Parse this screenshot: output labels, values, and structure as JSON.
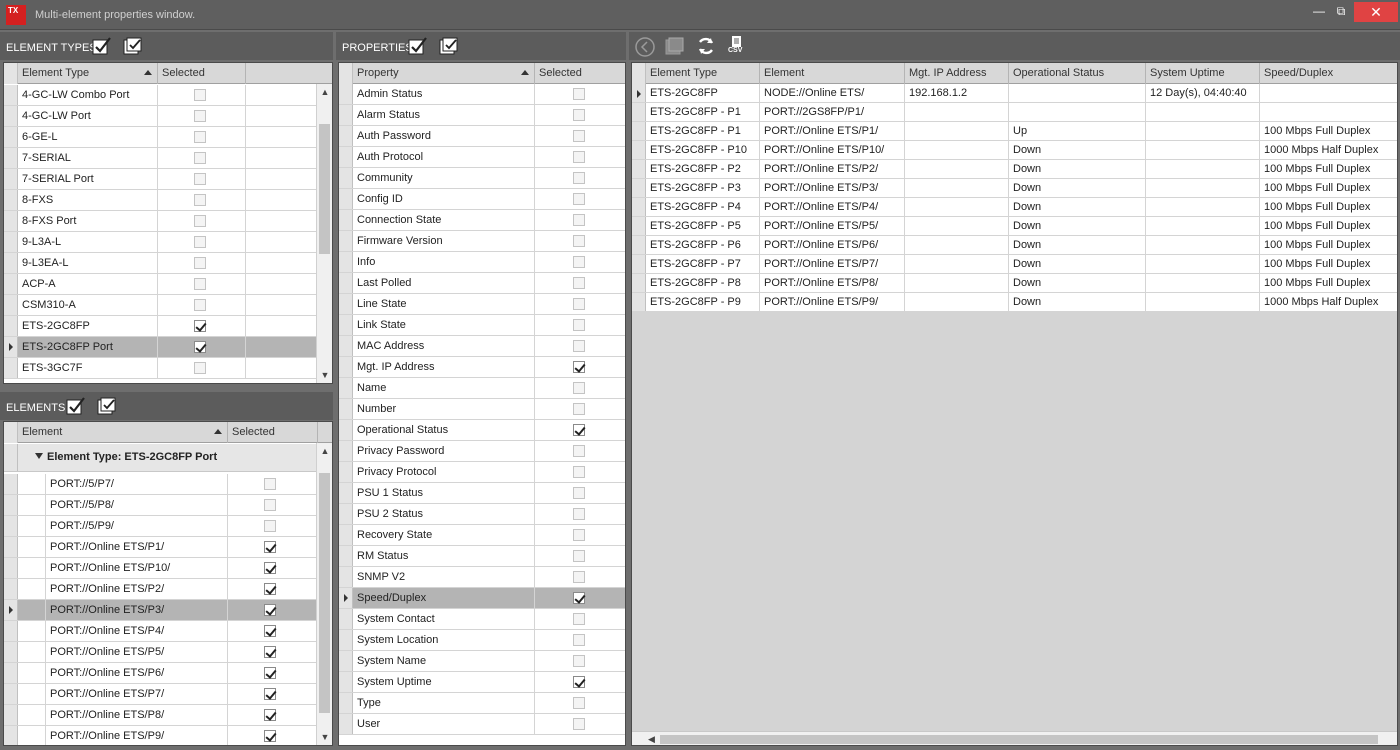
{
  "window": {
    "logo_text": "TX",
    "title": "Multi-element properties window.",
    "minimize": "—",
    "restore": "⧉",
    "close": "✕"
  },
  "element_types": {
    "label": "ELEMENT TYPES",
    "columns": [
      "Element Type",
      "Selected"
    ],
    "rows": [
      {
        "name": "4-GC-LW Combo Port",
        "checked": false
      },
      {
        "name": "4-GC-LW Port",
        "checked": false
      },
      {
        "name": "6-GE-L",
        "checked": false
      },
      {
        "name": "7-SERIAL",
        "checked": false
      },
      {
        "name": "7-SERIAL Port",
        "checked": false
      },
      {
        "name": "8-FXS",
        "checked": false
      },
      {
        "name": "8-FXS Port",
        "checked": false
      },
      {
        "name": "9-L3A-L",
        "checked": false
      },
      {
        "name": "9-L3EA-L",
        "checked": false
      },
      {
        "name": "ACP-A",
        "checked": false
      },
      {
        "name": "CSM310-A",
        "checked": false
      },
      {
        "name": "ETS-2GC8FP",
        "checked": true
      },
      {
        "name": "ETS-2GC8FP Port",
        "checked": true,
        "selected": true
      },
      {
        "name": "ETS-3GC7F",
        "checked": false
      }
    ]
  },
  "elements": {
    "label": "ELEMENTS",
    "columns": [
      "Element",
      "Selected"
    ],
    "group": "Element Type: ETS-2GC8FP Port",
    "rows": [
      {
        "name": "PORT://5/P7/",
        "checked": false
      },
      {
        "name": "PORT://5/P8/",
        "checked": false
      },
      {
        "name": "PORT://5/P9/",
        "checked": false
      },
      {
        "name": "PORT://Online ETS/P1/",
        "checked": true
      },
      {
        "name": "PORT://Online ETS/P10/",
        "checked": true
      },
      {
        "name": "PORT://Online ETS/P2/",
        "checked": true
      },
      {
        "name": "PORT://Online ETS/P3/",
        "checked": true,
        "selected": true
      },
      {
        "name": "PORT://Online ETS/P4/",
        "checked": true
      },
      {
        "name": "PORT://Online ETS/P5/",
        "checked": true
      },
      {
        "name": "PORT://Online ETS/P6/",
        "checked": true
      },
      {
        "name": "PORT://Online ETS/P7/",
        "checked": true
      },
      {
        "name": "PORT://Online ETS/P8/",
        "checked": true
      },
      {
        "name": "PORT://Online ETS/P9/",
        "checked": true
      }
    ]
  },
  "properties": {
    "label": "PROPERTIES",
    "columns": [
      "Property",
      "Selected"
    ],
    "rows": [
      {
        "name": "Admin Status",
        "checked": false
      },
      {
        "name": "Alarm Status",
        "checked": false
      },
      {
        "name": "Auth Password",
        "checked": false
      },
      {
        "name": "Auth Protocol",
        "checked": false
      },
      {
        "name": "Community",
        "checked": false
      },
      {
        "name": "Config ID",
        "checked": false
      },
      {
        "name": "Connection State",
        "checked": false
      },
      {
        "name": "Firmware Version",
        "checked": false
      },
      {
        "name": "Info",
        "checked": false
      },
      {
        "name": "Last Polled",
        "checked": false
      },
      {
        "name": "Line State",
        "checked": false
      },
      {
        "name": "Link State",
        "checked": false
      },
      {
        "name": "MAC Address",
        "checked": false
      },
      {
        "name": "Mgt. IP Address",
        "checked": true
      },
      {
        "name": "Name",
        "checked": false
      },
      {
        "name": "Number",
        "checked": false
      },
      {
        "name": "Operational Status",
        "checked": true
      },
      {
        "name": "Privacy Password",
        "checked": false
      },
      {
        "name": "Privacy Protocol",
        "checked": false
      },
      {
        "name": "PSU 1 Status",
        "checked": false
      },
      {
        "name": "PSU 2 Status",
        "checked": false
      },
      {
        "name": "Recovery State",
        "checked": false
      },
      {
        "name": "RM Status",
        "checked": false
      },
      {
        "name": "SNMP V2",
        "checked": false
      },
      {
        "name": "Speed/Duplex",
        "checked": true,
        "selected": true
      },
      {
        "name": "System Contact",
        "checked": false
      },
      {
        "name": "System Location",
        "checked": false
      },
      {
        "name": "System Name",
        "checked": false
      },
      {
        "name": "System Uptime",
        "checked": true
      },
      {
        "name": "Type",
        "checked": false
      },
      {
        "name": "User",
        "checked": false
      }
    ]
  },
  "results": {
    "csv_label": "CSV",
    "columns": [
      "Element Type",
      "Element",
      "Mgt. IP Address",
      "Operational Status",
      "System Uptime",
      "Speed/Duplex"
    ],
    "rows": [
      [
        "ETS-2GC8FP",
        "NODE://Online ETS/",
        "192.168.1.2",
        "",
        "12 Day(s), 04:40:40",
        ""
      ],
      [
        "ETS-2GC8FP - P1",
        "PORT://2GS8FP/P1/",
        "",
        "",
        "",
        ""
      ],
      [
        "ETS-2GC8FP - P1",
        "PORT://Online ETS/P1/",
        "",
        "Up",
        "",
        "100 Mbps Full Duplex"
      ],
      [
        "ETS-2GC8FP - P10",
        "PORT://Online ETS/P10/",
        "",
        "Down",
        "",
        "1000 Mbps Half Duplex"
      ],
      [
        "ETS-2GC8FP - P2",
        "PORT://Online ETS/P2/",
        "",
        "Down",
        "",
        "100 Mbps Full Duplex"
      ],
      [
        "ETS-2GC8FP - P3",
        "PORT://Online ETS/P3/",
        "",
        "Down",
        "",
        "100 Mbps Full Duplex"
      ],
      [
        "ETS-2GC8FP - P4",
        "PORT://Online ETS/P4/",
        "",
        "Down",
        "",
        "100 Mbps Full Duplex"
      ],
      [
        "ETS-2GC8FP - P5",
        "PORT://Online ETS/P5/",
        "",
        "Down",
        "",
        "100 Mbps Full Duplex"
      ],
      [
        "ETS-2GC8FP - P6",
        "PORT://Online ETS/P6/",
        "",
        "Down",
        "",
        "100 Mbps Full Duplex"
      ],
      [
        "ETS-2GC8FP - P7",
        "PORT://Online ETS/P7/",
        "",
        "Down",
        "",
        "100 Mbps Full Duplex"
      ],
      [
        "ETS-2GC8FP - P8",
        "PORT://Online ETS/P8/",
        "",
        "Down",
        "",
        "100 Mbps Full Duplex"
      ],
      [
        "ETS-2GC8FP - P9",
        "PORT://Online ETS/P9/",
        "",
        "Down",
        "",
        "1000 Mbps Half Duplex"
      ]
    ]
  }
}
